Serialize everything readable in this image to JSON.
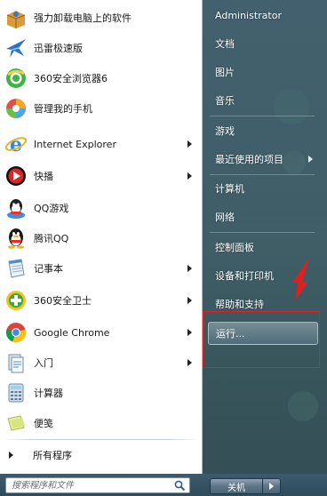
{
  "programs": [
    {
      "label": "强力卸载电脑上的软件",
      "icon": "uninstall-box-icon",
      "has_submenu": false
    },
    {
      "label": "迅雷极速版",
      "icon": "thunder-bird-icon",
      "has_submenu": false
    },
    {
      "label": "360安全浏览器6",
      "icon": "360-browser-icon",
      "has_submenu": false
    },
    {
      "label": "管理我的手机",
      "icon": "phone-manager-icon",
      "has_submenu": false
    },
    {
      "label": "Internet Explorer",
      "icon": "internet-explorer-icon",
      "has_submenu": true
    },
    {
      "label": "快播",
      "icon": "qvod-player-icon",
      "has_submenu": true
    },
    {
      "label": "QQ游戏",
      "icon": "qq-game-icon",
      "has_submenu": false
    },
    {
      "label": "腾讯QQ",
      "icon": "qq-penguin-icon",
      "has_submenu": false
    },
    {
      "label": "记事本",
      "icon": "notepad-icon",
      "has_submenu": true
    },
    {
      "label": "360安全卫士",
      "icon": "360-safeguard-icon",
      "has_submenu": true
    },
    {
      "label": "Google Chrome",
      "icon": "chrome-icon",
      "has_submenu": true
    },
    {
      "label": "入门",
      "icon": "getting-started-icon",
      "has_submenu": true
    },
    {
      "label": "计算器",
      "icon": "calculator-icon",
      "has_submenu": false
    },
    {
      "label": "便笺",
      "icon": "sticky-notes-icon",
      "has_submenu": false
    }
  ],
  "all_programs": {
    "label": "所有程序"
  },
  "search": {
    "placeholder": "搜索程序和文件"
  },
  "right_items": [
    {
      "label": "Administrator",
      "has_submenu": false
    },
    {
      "label": "文档",
      "has_submenu": false
    },
    {
      "label": "图片",
      "has_submenu": false
    },
    {
      "label": "音乐",
      "has_submenu": false
    },
    {
      "label": "游戏",
      "has_submenu": false
    },
    {
      "label": "最近使用的项目",
      "has_submenu": true
    },
    {
      "label": "计算机",
      "has_submenu": false
    },
    {
      "label": "网络",
      "has_submenu": false
    },
    {
      "label": "控制面板",
      "has_submenu": false
    },
    {
      "label": "设备和打印机",
      "has_submenu": false
    },
    {
      "label": "帮助和支持",
      "has_submenu": false
    }
  ],
  "run": {
    "label": "运行..."
  },
  "shutdown": {
    "label": "关机"
  },
  "colors": {
    "highlight_box": "#e02020",
    "left_pane_bg": "#ffffff",
    "right_pane_bg": "#2c4c60"
  }
}
